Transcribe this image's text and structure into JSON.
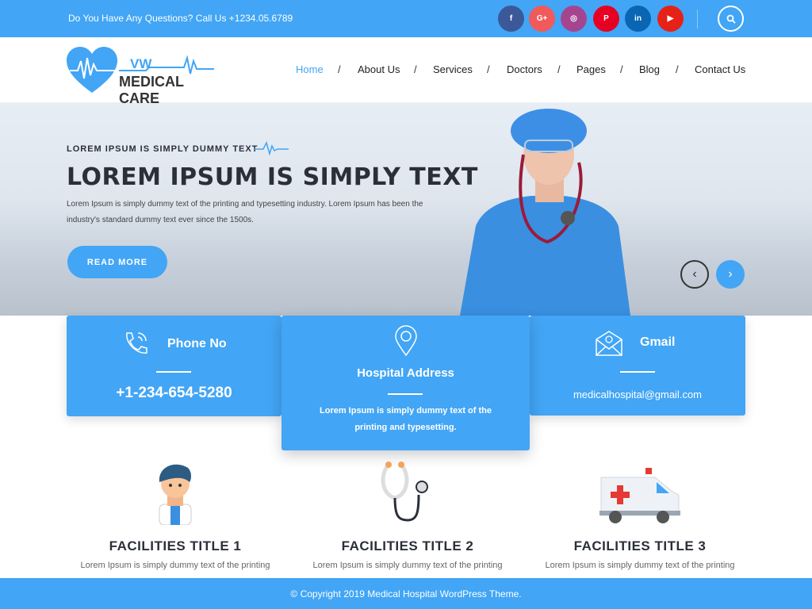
{
  "topbar": {
    "question": "Do You Have Any Questions? Call Us +1234.05.6789",
    "social": [
      {
        "name": "facebook",
        "glyph": "f",
        "color": "#3b5998"
      },
      {
        "name": "google-plus",
        "glyph": "G+",
        "color": "#f05a5a"
      },
      {
        "name": "instagram",
        "glyph": "◎",
        "color": "#a5458f"
      },
      {
        "name": "pinterest",
        "glyph": "P",
        "color": "#e60023"
      },
      {
        "name": "linkedin",
        "glyph": "in",
        "color": "#0a66b2"
      },
      {
        "name": "youtube",
        "glyph": "▶",
        "color": "#e62117"
      }
    ]
  },
  "logo": {
    "top": "VW",
    "bottom": "MEDICAL CARE"
  },
  "nav": [
    "Home",
    "About Us",
    "Services",
    "Doctors",
    "Pages",
    "Blog",
    "Contact Us"
  ],
  "hero": {
    "subtitle": "LOREM IPSUM IS SIMPLY DUMMY TEXT",
    "title": "LOREM IPSUM IS SIMPLY TEXT",
    "text": "Lorem Ipsum is simply dummy text of the printing and typesetting industry. Lorem Ipsum has been the industry's standard dummy text ever since the 1500s.",
    "button": "READ MORE",
    "prev": "‹",
    "next": "›"
  },
  "cards": {
    "phone": {
      "title": "Phone No",
      "value": "+1-234-654-5280"
    },
    "address": {
      "title": "Hospital Address",
      "value": "Lorem Ipsum is simply dummy text of the printing and typesetting."
    },
    "gmail": {
      "title": "Gmail",
      "value": "medicalhospital@gmail.com"
    }
  },
  "facilities": [
    {
      "title": "FACILITIES TITLE 1",
      "text": "Lorem Ipsum is simply dummy text of the printing",
      "icon": "doctor-icon"
    },
    {
      "title": "FACILITIES TITLE 2",
      "text": "Lorem Ipsum is simply dummy text of the printing",
      "icon": "stethoscope-icon"
    },
    {
      "title": "FACILITIES TITLE 3",
      "text": "Lorem Ipsum is simply dummy text of the printing",
      "icon": "ambulance-icon"
    }
  ],
  "footer": "© Copyright 2019 Medical Hospital WordPress Theme.",
  "colors": {
    "accent": "#42a5f5",
    "dark": "#2b2f3a"
  }
}
